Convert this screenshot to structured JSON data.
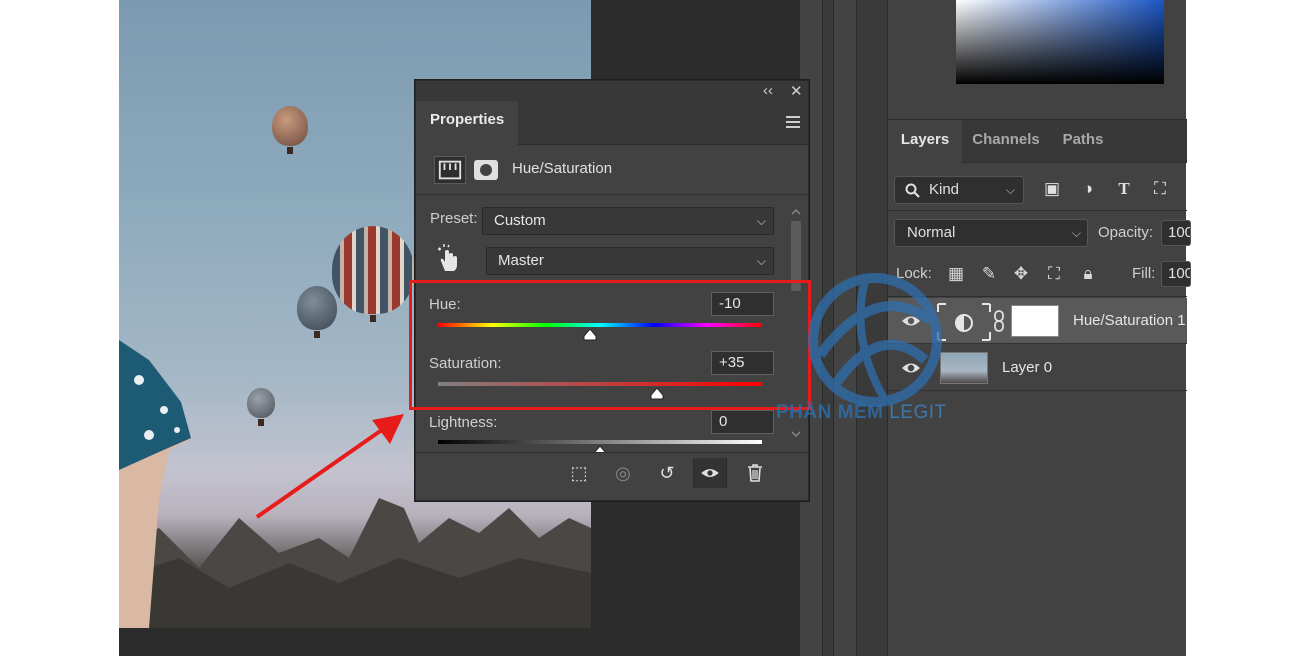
{
  "properties_panel": {
    "collapse_glyph": "‹‹",
    "close_glyph": "✕",
    "tab_label": "Properties",
    "adjustment_title": "Hue/Saturation",
    "preset_label": "Preset:",
    "preset_value": "Custom",
    "channel_value": "Master",
    "hue": {
      "label": "Hue:",
      "value": "-10",
      "level": 0.47
    },
    "saturation": {
      "label": "Saturation:",
      "value": "+35",
      "level": 0.675
    },
    "lightness": {
      "label": "Lightness:",
      "value": "0",
      "level": 0.5
    },
    "bottom_icons": [
      "clip-to-layer-icon",
      "view-previous-state-icon",
      "reset-icon",
      "visibility-eye-icon",
      "delete-icon"
    ]
  },
  "layers_panel": {
    "tabs": [
      {
        "label": "Layers",
        "active": true
      },
      {
        "label": "Channels",
        "active": false
      },
      {
        "label": "Paths",
        "active": false
      }
    ],
    "filter_kind": "Kind",
    "blend_mode": "Normal",
    "opacity_label": "Opacity:",
    "opacity_value": "100",
    "lock_label": "Lock:",
    "fill_label": "Fill:",
    "fill_value": "100",
    "layers": [
      {
        "name": "Hue/Saturation 1",
        "selected": true,
        "visible": true
      },
      {
        "name": "Layer 0",
        "selected": false,
        "visible": true
      }
    ]
  },
  "watermark": {
    "bold": "PHẦN MỀM",
    "light": "LEGIT"
  },
  "colors": {
    "highlight": "#e81b1b",
    "panel_bg": "#424242",
    "watermark": "#2d6fae"
  }
}
